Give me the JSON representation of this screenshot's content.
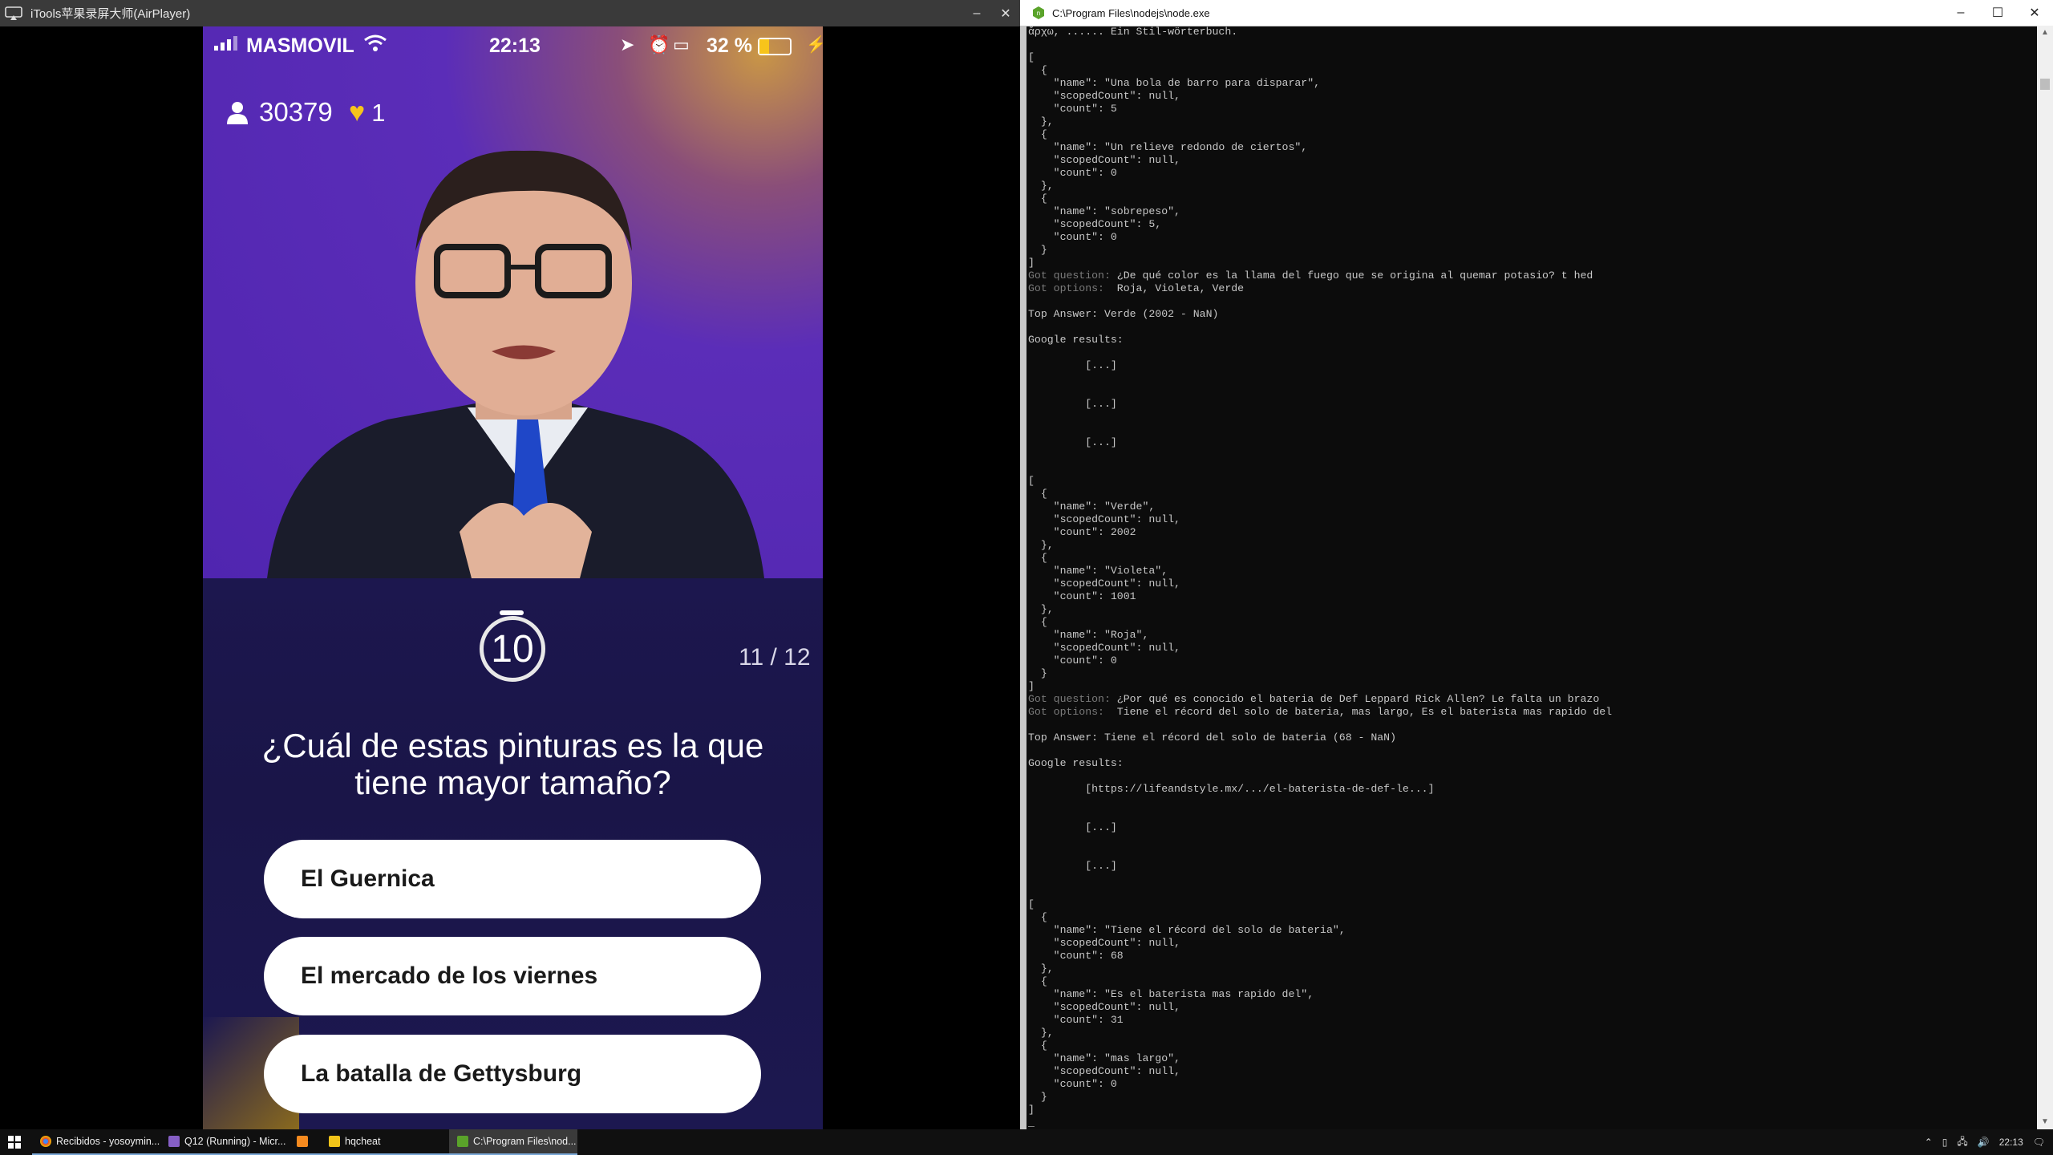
{
  "left_window": {
    "title": "iTools苹果录屏大师(AirPlayer)",
    "controls": {
      "minimize": "–",
      "close": "✕"
    }
  },
  "phone": {
    "status": {
      "carrier": "MASMOVIL",
      "time": "22:13",
      "battery_pct": "32 %",
      "battery_level": 0.32
    },
    "players": "30379",
    "lives": "1",
    "timer": "10",
    "counter": "11 / 12",
    "question": "¿Cuál de estas pinturas es la que tiene mayor tamaño?",
    "answers": [
      "El Guernica",
      "El mercado de los viernes",
      "La batalla de Gettysburg"
    ],
    "colors": {
      "video_bg": "#5025b0",
      "quiz_bg": "#1c174e",
      "heart": "#f7c41b"
    }
  },
  "right_window": {
    "title": "C:\\Program Files\\nodejs\\node.exe",
    "controls": {
      "minimize": "–",
      "maximize": "☐",
      "close": "✕"
    }
  },
  "console_lines": [
    "ἄρχω, ...... Ein Stil-wörterbuch.",
    "",
    "[",
    "  {",
    "    \"name\": \"Una bola de barro para disparar\",",
    "    \"scopedCount\": null,",
    "    \"count\": 5",
    "  },",
    "  {",
    "    \"name\": \"Un relieve redondo de ciertos\",",
    "    \"scopedCount\": null,",
    "    \"count\": 0",
    "  },",
    "  {",
    "    \"name\": \"sobrepeso\",",
    "    \"scopedCount\": 5,",
    "    \"count\": 0",
    "  }",
    "]",
    "Got question: ¿De qué color es la llama del fuego que se origina al quemar potasio? t hed",
    "Got options:  Roja, Violeta, Verde",
    "",
    "Top Answer: Verde (2002 - NaN)",
    "",
    "Google results:",
    "",
    "         [...]",
    "",
    "",
    "         [...]",
    "",
    "",
    "         [...]",
    "",
    "",
    "[",
    "  {",
    "    \"name\": \"Verde\",",
    "    \"scopedCount\": null,",
    "    \"count\": 2002",
    "  },",
    "  {",
    "    \"name\": \"Violeta\",",
    "    \"scopedCount\": null,",
    "    \"count\": 1001",
    "  },",
    "  {",
    "    \"name\": \"Roja\",",
    "    \"scopedCount\": null,",
    "    \"count\": 0",
    "  }",
    "]",
    "Got question: ¿Por qué es conocido el bateria de Def Leppard Rick Allen? Le falta un brazo",
    "Got options:  Tiene el récord del solo de bateria, mas largo, Es el baterista mas rapido del",
    "",
    "Top Answer: Tiene el récord del solo de bateria (68 - NaN)",
    "",
    "Google results:",
    "",
    "         [https://lifeandstyle.mx/.../el-baterista-de-def-le...]",
    "",
    "",
    "         [...]",
    "",
    "",
    "         [...]",
    "",
    "",
    "[",
    "  {",
    "    \"name\": \"Tiene el récord del solo de bateria\",",
    "    \"scopedCount\": null,",
    "    \"count\": 68",
    "  },",
    "  {",
    "    \"name\": \"Es el baterista mas rapido del\",",
    "    \"scopedCount\": null,",
    "    \"count\": 31",
    "  },",
    "  {",
    "    \"name\": \"mas largo\",",
    "    \"scopedCount\": null,",
    "    \"count\": 0",
    "  }",
    "]",
    "_"
  ],
  "taskbar": {
    "apps": [
      {
        "label": "Recibidos - yosoymin...",
        "icon": "chrome-icon"
      },
      {
        "label": "Q12 (Running) - Micr...",
        "icon": "visual-studio-icon"
      },
      {
        "label": "",
        "icon": "sublime-icon"
      },
      {
        "label": "hqcheat",
        "icon": "folder-icon"
      },
      {
        "label": "C:\\Program Files\\nod...",
        "icon": "node-icon"
      }
    ],
    "clock": "22:13"
  }
}
